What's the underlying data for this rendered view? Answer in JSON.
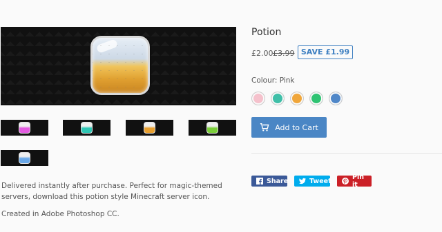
{
  "product": {
    "title": "Potion",
    "price": "£2.00",
    "compare_price": "£3.99",
    "save_label": "SAVE £1.99",
    "colour_label": "Colour: Pink",
    "swatches": [
      {
        "name": "Pink",
        "color": "#f5c1cc"
      },
      {
        "name": "Teal",
        "color": "#3fbfa8"
      },
      {
        "name": "Orange",
        "color": "#f0a63a"
      },
      {
        "name": "Green",
        "color": "#2ec372"
      },
      {
        "name": "Blue",
        "color": "#4f87c8"
      }
    ],
    "add_to_cart": "Add to Cart",
    "description": "Delivered instantly after purchase. Perfect for magic-themed servers, download this potion style Minecraft server icon.",
    "created": "Created in Adobe Photoshop CC."
  },
  "share": {
    "facebook": "Share",
    "twitter": "Tweet",
    "pinterest": "Pin it"
  },
  "colors": {
    "accent": "#4a86c5",
    "facebook": "#3b5998",
    "twitter": "#00aced",
    "pinterest": "#cb2027"
  }
}
